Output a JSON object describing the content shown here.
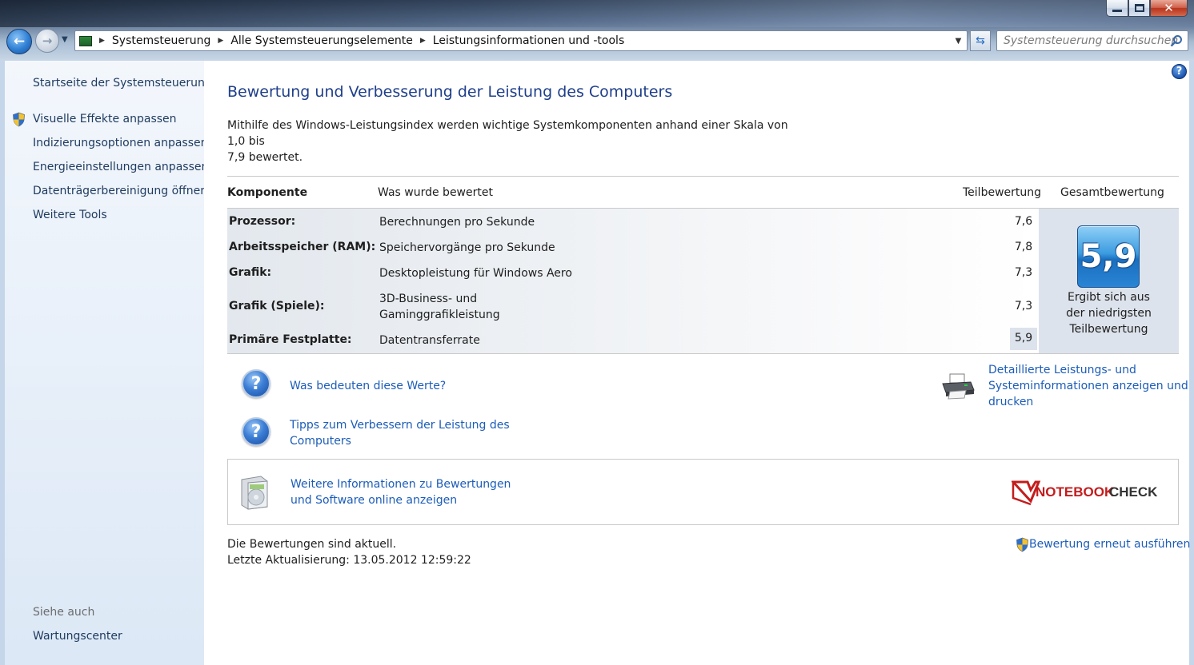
{
  "window": {
    "controls": {
      "minimize_icon": "minimize-icon",
      "maximize_icon": "maximize-icon",
      "close_icon": "close-icon",
      "close_glyph": "✕"
    }
  },
  "navigation": {
    "back_glyph": "←",
    "forward_glyph": "→",
    "breadcrumbs": [
      "Systemsteuerung",
      "Alle Systemsteuerungselemente",
      "Leistungsinformationen und -tools"
    ],
    "search_placeholder": "Systemsteuerung durchsuchen"
  },
  "sidebar": {
    "home_link": "Startseite der Systemsteuerung",
    "items": [
      {
        "label": "Visuelle Effekte anpassen",
        "icon": "shield-icon"
      },
      {
        "label": "Indizierungsoptionen anpassen"
      },
      {
        "label": "Energieeinstellungen anpassen"
      },
      {
        "label": "Datenträgerbereinigung öffnen"
      },
      {
        "label": "Weitere Tools"
      }
    ],
    "see_also_heading": "Siehe auch",
    "see_also_items": [
      "Wartungscenter"
    ]
  },
  "main": {
    "title": "Bewertung und Verbesserung der Leistung des Computers",
    "intro_line1": "Mithilfe des Windows-Leistungsindex werden wichtige Systemkomponenten anhand einer Skala von 1,0 bis",
    "intro_line2": "7,9 bewertet.",
    "table": {
      "headers": {
        "component": "Komponente",
        "rated": "Was wurde bewertet",
        "subscore": "Teilbewertung",
        "overall": "Gesamtbewertung"
      },
      "rows": [
        {
          "component": "Prozessor:",
          "rated": "Berechnungen pro Sekunde",
          "score": "7,6"
        },
        {
          "component": "Arbeitsspeicher (RAM):",
          "rated": "Speichervorgänge pro Sekunde",
          "score": "7,8"
        },
        {
          "component": "Grafik:",
          "rated": "Desktopleistung für Windows Aero",
          "score": "7,3"
        },
        {
          "component": "Grafik (Spiele):",
          "rated_line1": "3D-Business- und",
          "rated_line2": "Gaminggrafikleistung",
          "score": "7,3"
        },
        {
          "component": "Primäre Festplatte:",
          "rated": "Datentransferrate",
          "score": "5,9"
        }
      ],
      "overall_score": "5,9",
      "overall_caption_line1": "Ergibt sich aus",
      "overall_caption_line2": "der niedrigsten",
      "overall_caption_line3": "Teilbewertung"
    },
    "links": {
      "what_mean": "Was bedeuten diese Werte?",
      "tips_line1": "Tipps zum Verbessern der Leistung des",
      "tips_line2": "Computers",
      "details_line1": "Detaillierte Leistungs- und",
      "details_line2": "Systeminformationen anzeigen und",
      "details_line3": "drucken",
      "more_info_line1": "Weitere Informationen zu Bewertungen",
      "more_info_line2": "und Software online anzeigen"
    },
    "watermark": {
      "text": "NOTEBOOKCHECK",
      "color": "#c41c1c"
    },
    "status_line1": "Die Bewertungen sind aktuell.",
    "status_line2": "Letzte Aktualisierung: 13.05.2012 12:59:22",
    "rerun": "Bewertung erneut ausführen"
  },
  "colors": {
    "link": "#1c5db8",
    "title": "#1f3f8a",
    "badge": "#2a85d4"
  }
}
